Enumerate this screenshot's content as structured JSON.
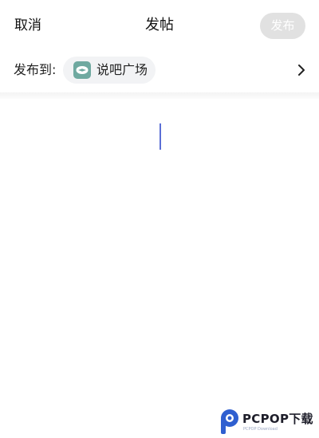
{
  "nav": {
    "cancel_label": "取消",
    "title": "发帖",
    "publish_label": "发布"
  },
  "target": {
    "label": "发布到:",
    "channel_name": "说吧广场",
    "channel_icon": "chat-bubble-icon"
  },
  "editor": {
    "content": ""
  },
  "watermark": {
    "text": "PCPOP下载",
    "subtext": "PCPOP Download"
  },
  "colors": {
    "publish_disabled_bg": "#e1e1e1",
    "chip_bg": "#f2f3f5",
    "channel_icon_bg": "#6fa9a0",
    "caret": "#5b6fd6",
    "watermark_brand": "#2f5fd0"
  }
}
